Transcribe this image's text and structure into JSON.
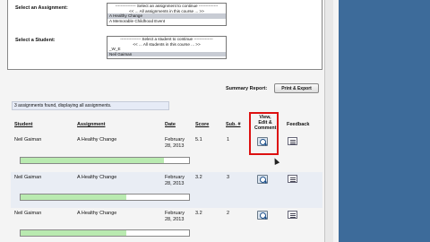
{
  "assignment_select": {
    "label": "Select an Assignment:",
    "options": [
      "--------------- Select an assignment to continue --------------",
      "<< ... All assignments in this course ... >>",
      "A Healthy Change",
      "A Memorable Childhood Event"
    ],
    "selected_index": 2
  },
  "student_select": {
    "label": "Select a Student:",
    "options": [
      "--------------- Select a student to continue --------------",
      "<< ... All students in this course ... >>",
      "_W_E",
      "Neil Gaiman"
    ],
    "selected_index": 3
  },
  "summary": {
    "label": "Summary Report:",
    "button_label": "Print & Export"
  },
  "count_text": "3 assignments found, displaying all assignments.",
  "table": {
    "headers": {
      "student": "Student",
      "assignment": "Assignment",
      "date": "Date",
      "score": "Score",
      "sub": "Sub. #",
      "view_lines": [
        "View,",
        "Edit &",
        "Comment"
      ],
      "feedback": "Feedback"
    },
    "rows": [
      {
        "student": "Neil Gaiman",
        "assignment": "A Healthy Change",
        "date_line1": "February",
        "date_line2": "28, 2013",
        "score": "5.1",
        "sub": "1",
        "progress": 0.85
      },
      {
        "student": "Neil Gaiman",
        "assignment": "A Healthy Change",
        "date_line1": "February",
        "date_line2": "28, 2013",
        "score": "3.2",
        "sub": "3",
        "progress": 0.63
      },
      {
        "student": "Neil Gaiman",
        "assignment": "A Healthy Change",
        "date_line1": "February",
        "date_line2": "28, 2013",
        "score": "3.2",
        "sub": "2",
        "progress": 0.63
      }
    ]
  },
  "colors": {
    "desktop_bg": "#3d6b9a",
    "progress_fill": "#b9eab0",
    "highlight_box": "#dd1111"
  },
  "icons": {
    "view": "magnifier-icon",
    "feedback": "document-icon"
  }
}
